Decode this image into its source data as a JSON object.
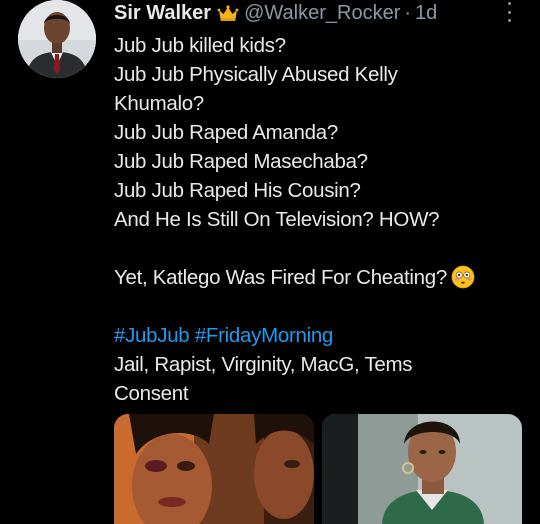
{
  "tweet": {
    "author_name": "Sir Walker",
    "handle": "@Walker_Rocker",
    "separator": "·",
    "time": "1d",
    "lines": [
      "Jub Jub killed kids?",
      "Jub Jub Physically Abused Kelly",
      "Khumalo?",
      "Jub Jub Raped Amanda?",
      "Jub Jub Raped Masechaba?",
      "Jub Jub Raped His Cousin?",
      "And He Is Still On Television? HOW?"
    ],
    "line_after_blank": "Yet, Katlego Was Fired For Cheating?",
    "hashtags": [
      "#JubJub",
      "#FridayMorning"
    ],
    "tags_line_1": "Jail, Rapist, Virginity, MacG, Tems",
    "tags_line_2": "Consent"
  },
  "icons": {
    "badge": "crown-icon",
    "more": "more-dots-icon",
    "emoji": "flushed-face-emoji"
  },
  "colors": {
    "background": "#000000",
    "text": "#e7e9ea",
    "secondary": "#8b98a5",
    "link": "#1d9bf0"
  }
}
